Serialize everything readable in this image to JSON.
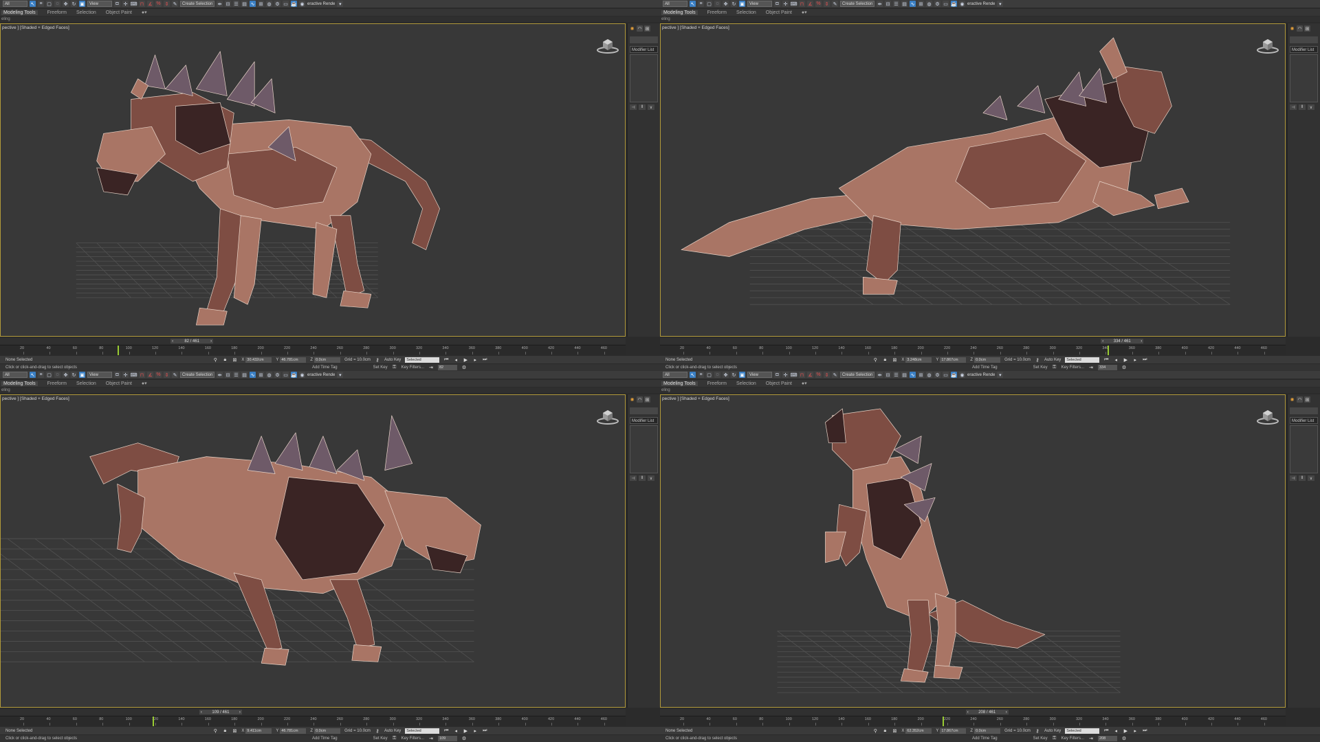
{
  "colors": {
    "viewport_bg": "#383838",
    "viewport_border": "#b39b3a",
    "ui_bg": "#2b2b2b",
    "toolbar_bg": "#3c3c3c",
    "mesh_light": "#a97565",
    "mesh_mid": "#7e4d43",
    "mesh_dark": "#3a2424",
    "spikes": "#6e5a68",
    "wire": "#e8d4c8",
    "timeslider_head": "#9acd32"
  },
  "ribbon": {
    "tabs": [
      "Modeling Tools",
      "Freeform",
      "Selection",
      "Object Paint"
    ],
    "sub_label": "eling"
  },
  "toolbar": {
    "selection_filter": "All",
    "view_dropdown": "View",
    "named_selection": "Create Selection Se",
    "render_label": "eractive Rende"
  },
  "command_panel": {
    "modifier_list": "Modifier List"
  },
  "ruler": {
    "ticks": [
      "20",
      "40",
      "60",
      "80",
      "100",
      "120",
      "140",
      "160",
      "180",
      "200",
      "220",
      "240",
      "260",
      "280",
      "300",
      "320",
      "340",
      "360",
      "380",
      "400",
      "420",
      "440",
      "460"
    ]
  },
  "status": {
    "selection": "None Selected",
    "prompt": "Click or click-and-drag to select objects",
    "grid": "Grid = 10.0cm",
    "add_time_tag": "Add Time Tag",
    "auto_key": "Auto Key",
    "set_key": "Set Key",
    "key_mode": "Selected",
    "key_filters": "Key Filters..."
  },
  "viewports": [
    {
      "label": "[ + ] [Perspective ] [Shaded + Edged Faces ]",
      "label_visible": "pective ] [Shaded + Edged Faces]",
      "frame": "82 / 461",
      "frame_value": "82",
      "x": "30.432cm",
      "y": "46.781cm",
      "z": "0.0cm"
    },
    {
      "label": "[ + ] [Perspective ] [Shaded + Edged Faces ]",
      "label_visible": "pective ] [Shaded + Edged Faces]",
      "frame": "334 / 461",
      "frame_value": "334",
      "x": "3.248cm",
      "y": "17.867cm",
      "z": "0.0cm"
    },
    {
      "label": "[ + ] [Perspective ] [Shaded + Edged Faces ]",
      "label_visible": "pective ] [Shaded + Edged Faces]",
      "frame": "109 / 461",
      "frame_value": "109",
      "x": "9.411cm",
      "y": "46.781cm",
      "z": "0.0cm"
    },
    {
      "label": "[ + ] [Perspective ] [Shaded + Edged Faces ]",
      "label_visible": "pective ] [Shaded + Edged Faces]",
      "frame": "208 / 461",
      "frame_value": "208",
      "x": "62.352cm",
      "y": "17.867cm",
      "z": "0.0cm"
    }
  ],
  "scenes": [
    {
      "pose": "standing-growl",
      "time_fraction": 0.178
    },
    {
      "pose": "running-leap",
      "time_fraction": 0.724
    },
    {
      "pose": "crouching-lunge",
      "time_fraction": 0.236
    },
    {
      "pose": "rearing-howl",
      "time_fraction": 0.451
    }
  ]
}
